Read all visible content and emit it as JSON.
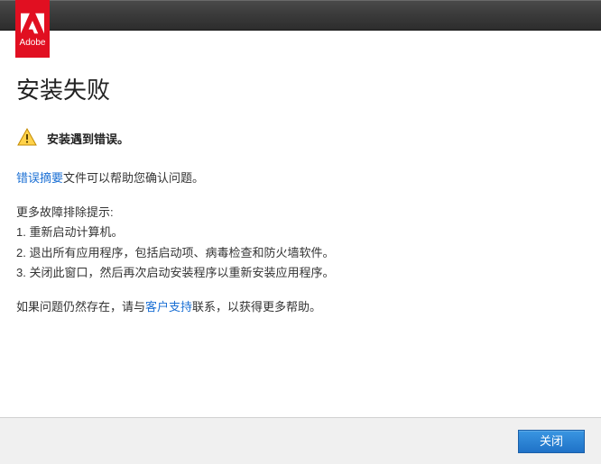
{
  "brand": {
    "name": "Adobe"
  },
  "title": "安装失败",
  "error": {
    "message": "安装遇到错误。"
  },
  "summary": {
    "link_label": "错误摘要",
    "rest": "文件可以帮助您确认问题。"
  },
  "tips": {
    "heading": "更多故障排除提示:",
    "items": [
      "1. 重新启动计算机。",
      "2. 退出所有应用程序，包括启动项、病毒检查和防火墙软件。",
      "3. 关闭此窗口，然后再次启动安装程序以重新安装应用程序。"
    ]
  },
  "support": {
    "before": "如果问题仍然存在，请与",
    "link_label": "客户支持",
    "after": "联系，以获得更多帮助。"
  },
  "buttons": {
    "close": "关闭"
  }
}
